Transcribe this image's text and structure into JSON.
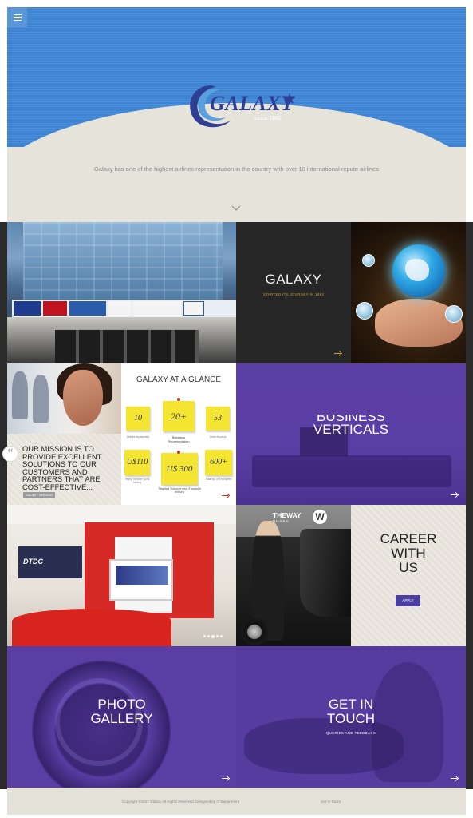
{
  "hero": {
    "logo_text": "GALAXY",
    "logo_since": "since 1962",
    "tagline": "Galaxy has one of the highest airlines representation in the country with over 10 international repute airlines"
  },
  "tiles": {
    "galaxy": {
      "title": "GALAXY",
      "subtitle": "STARTED ITS JOURNEY IN 1962"
    },
    "mission": {
      "text": "OUR MISSION IS TO PROVIDE EXCELLENT SOLUTIONS TO OUR CUSTOMERS AND PARTNERS THAT ARE COST-EFFECTIVE...",
      "button": "GALAXY MISSION"
    },
    "glance": {
      "title": "GALAXY AT A GLANCE",
      "notes": [
        {
          "value": "10",
          "caption": "Airlines represented"
        },
        {
          "value": "20+",
          "caption": "Business Representation"
        },
        {
          "value": "53",
          "caption": "Years Success"
        },
        {
          "value": "U$110",
          "caption": "Yearly Turnover (US$ million)"
        },
        {
          "value": "U$ 300",
          "caption": "Targeted Turnover next 3 years(in million)"
        },
        {
          "value": "600+",
          "caption": "Total No. of Employees"
        }
      ]
    },
    "business": {
      "title_partial": "BUSINESS",
      "title": "VERTICALS"
    },
    "theway": {
      "brand": "THEWAY",
      "city": "DHAKA",
      "mark": "W"
    },
    "career": {
      "line1": "CAREER",
      "line2": "WITH",
      "line3": "US",
      "button": "APPLY"
    },
    "photo": {
      "line1": "PHOTO",
      "line2": "GALLERY"
    },
    "touch": {
      "line1": "GET IN",
      "line2": "TOUCH",
      "subtitle": "QUERIES AND FEEDBACK"
    }
  },
  "office": {
    "sign": "DTDC"
  },
  "footer": {
    "copyright": "Copyright ©2017 Galaxy All Rights Reserved. Designed by IT Department",
    "link": "Get In Touch"
  },
  "colors": {
    "hero_blue": "#3f84d2",
    "brand_purple": "#5a3ea4",
    "accent_gold": "#d19a2f",
    "cream": "#e6e3da"
  }
}
